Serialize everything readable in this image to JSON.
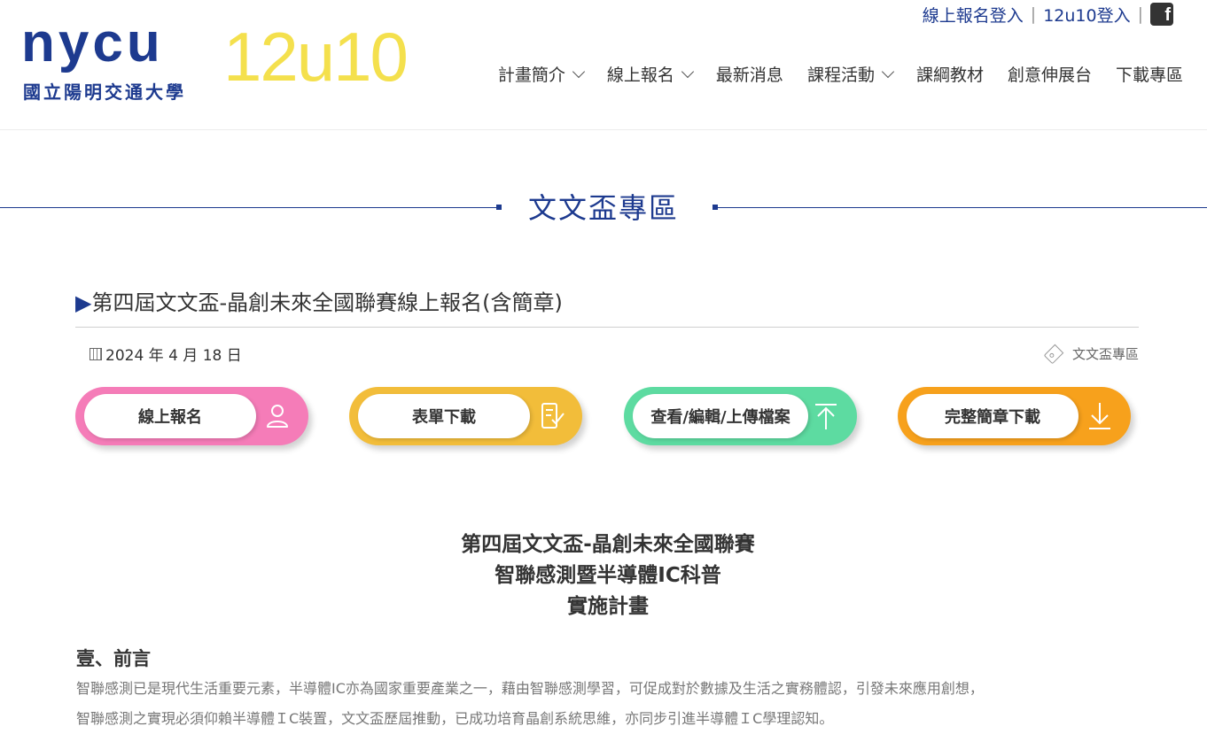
{
  "header": {
    "logo": {
      "brand": "nycu",
      "university": "國立陽明交通大學",
      "program": "12u10"
    },
    "top_links": [
      "線上報名登入",
      "12u10登入"
    ],
    "social_icon": "facebook-icon",
    "nav": [
      {
        "label": "計畫簡介",
        "dropdown": true
      },
      {
        "label": "線上報名",
        "dropdown": true
      },
      {
        "label": "最新消息",
        "dropdown": false
      },
      {
        "label": "課程活動",
        "dropdown": true
      },
      {
        "label": "課綱教材",
        "dropdown": false
      },
      {
        "label": "創意伸展台",
        "dropdown": false
      },
      {
        "label": "下載專區",
        "dropdown": false
      }
    ]
  },
  "section": {
    "title": "文文盃專區"
  },
  "post": {
    "title": "第四屆文文盃-晶創未來全國聯賽線上報名(含簡章)",
    "date": "2024 年 4 月 18 日",
    "category": "文文盃專區"
  },
  "buttons": [
    {
      "label": "線上報名",
      "icon": "user-icon",
      "color": "#f57cb8"
    },
    {
      "label": "表單下載",
      "icon": "form-icon",
      "color": "#f2bd3a"
    },
    {
      "label": "查看/編輯/上傳檔案",
      "icon": "upload-arrow-icon",
      "color": "#5ddba1"
    },
    {
      "label": "完整簡章下載",
      "icon": "download-arrow-icon",
      "color": "#f7a11c"
    }
  ],
  "document": {
    "heading": [
      "第四屆文文盃-晶創未來全國聯賽",
      "智聯感測暨半導體IC科普",
      "實施計畫"
    ],
    "section1_title": "壹、前言",
    "section1_lines": [
      "智聯感測已是現代生活重要元素，半導體IC亦為國家重要產業之一，藉由智聯感測學習，可促成對於數據及生活之實務體認，引發未來應用創想，",
      "智聯感測之實現必須仰賴半導體ＩC裝置，文文盃歷屆推動，已成功培育晶創系統思維，亦同步引進半導體ＩC學理認知。"
    ]
  }
}
